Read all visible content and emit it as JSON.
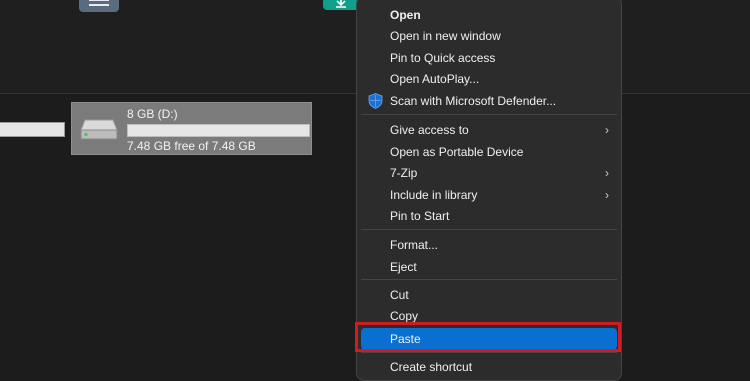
{
  "drive": {
    "name": "8 GB (D:)",
    "free_text": "7.48 GB free of 7.48 GB",
    "used_fraction": 0.0
  },
  "context_menu": {
    "items": [
      {
        "label": "Open",
        "bold": true
      },
      {
        "label": "Open in new window"
      },
      {
        "label": "Pin to Quick access"
      },
      {
        "label": "Open AutoPlay..."
      },
      {
        "label": "Scan with Microsoft Defender...",
        "icon": "shield-icon"
      },
      {
        "label": "Give access to",
        "submenu": true
      },
      {
        "label": "Open as Portable Device"
      },
      {
        "label": "7-Zip",
        "submenu": true
      },
      {
        "label": "Include in library",
        "submenu": true
      },
      {
        "label": "Pin to Start"
      },
      {
        "label": "Format..."
      },
      {
        "label": "Eject"
      },
      {
        "label": "Cut"
      },
      {
        "label": "Copy"
      },
      {
        "label": "Paste",
        "highlighted": true
      },
      {
        "label": "Create shortcut"
      }
    ]
  },
  "colors": {
    "highlight": "#0a6fd0",
    "annotation": "#d01b22",
    "menu_background": "#2c2c2c",
    "page_background": "#1c1c1c"
  }
}
